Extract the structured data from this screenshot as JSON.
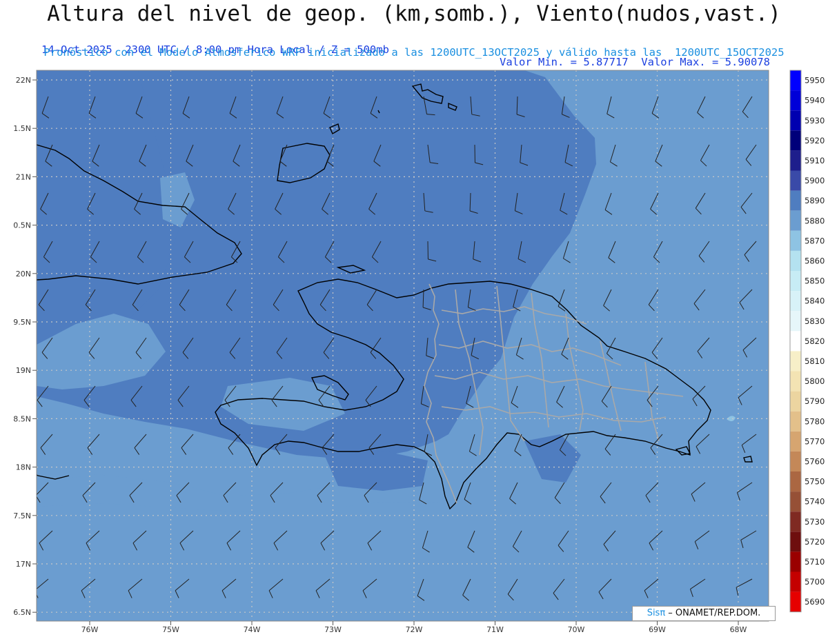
{
  "header": {
    "title": "Altura del nivel de geop. (km,somb.), Viento(nudos,vast.)",
    "left_info": "14-Oct-2025  2300 UTC / 8:00 pm Hora Local / Z = 500mb",
    "right_info": "Valor Min. = 5.87717  Valor Max. = 5.90078",
    "model_info": "Pronóstico con el Modelo Atmosferico WRF inicializado a las 1200UTC_13OCT2025 y válido hasta las  1200UTC_15OCT2025"
  },
  "map": {
    "lat_labels": [
      "22N",
      "1.5N",
      "21N",
      "0.5N",
      "20N",
      "9.5N",
      "19N",
      "8.5N",
      "18N",
      "7.5N",
      "17N",
      "6.5N"
    ],
    "lon_labels": [
      "76W",
      "75W",
      "74W",
      "73W",
      "72W",
      "71W",
      "70W",
      "69W",
      "68W"
    ]
  },
  "colorbar": {
    "levels": [
      "5950",
      "5940",
      "5930",
      "5920",
      "5910",
      "5900",
      "5890",
      "5880",
      "5870",
      "5860",
      "5850",
      "5840",
      "5830",
      "5820",
      "5810",
      "5800",
      "5790",
      "5780",
      "5770",
      "5760",
      "5750",
      "5740",
      "5730",
      "5720",
      "5710",
      "5700",
      "5690"
    ],
    "colors": [
      "#0000ff",
      "#0000d8",
      "#0000b0",
      "#00007a",
      "#1e1e8c",
      "#3a4aa8",
      "#4f7dc0",
      "#6b9dd0",
      "#8ec3e3",
      "#b4e2f0",
      "#c7ecf5",
      "#d8f2f8",
      "#e6f6fa",
      "#ffffff",
      "#f7efc8",
      "#f3e3b3",
      "#ecd5a0",
      "#e3c08a",
      "#d6a570",
      "#c48858",
      "#ab6742",
      "#965036",
      "#7f2a22",
      "#6e0e0e",
      "#9a0000",
      "#c40000",
      "#e60000"
    ]
  },
  "fill_colors": {
    "dark": "#4f7dc0",
    "mid": "#6b9dd0",
    "light": "#8ec3e3"
  },
  "credit": {
    "brand": "Sisπ",
    "org": " – ONAMET/REP.DOM."
  }
}
